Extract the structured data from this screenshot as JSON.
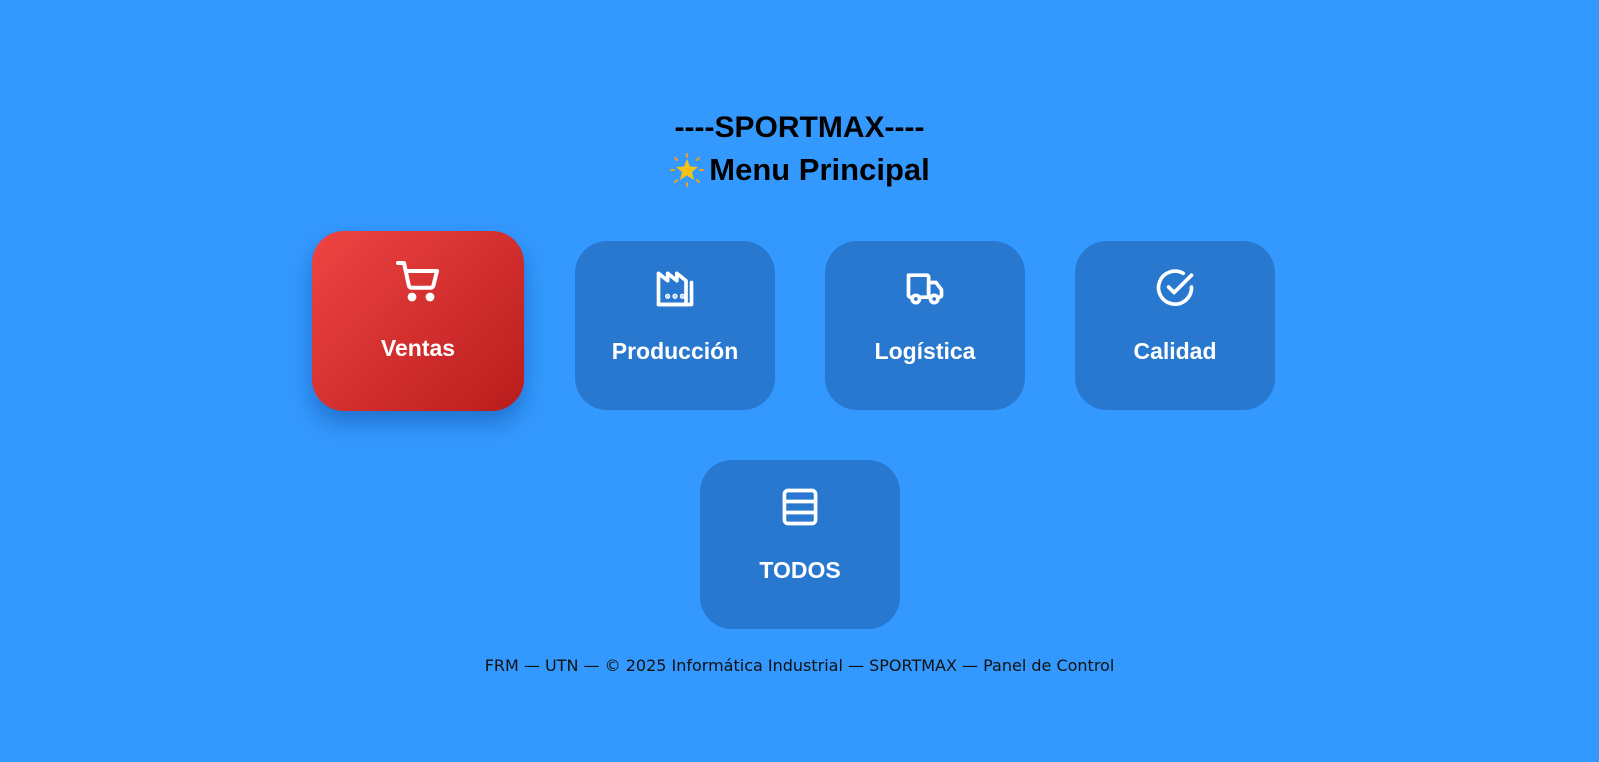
{
  "header": {
    "brand": "----SPORTMAX----",
    "menu_title": "Menu Principal",
    "menu_icon": "star-icon"
  },
  "cards": [
    {
      "label": "Ventas",
      "icon": "cart-icon",
      "active": true
    },
    {
      "label": "Producción",
      "icon": "factory-icon",
      "active": false
    },
    {
      "label": "Logística",
      "icon": "truck-icon",
      "active": false
    },
    {
      "label": "Calidad",
      "icon": "check-circle-icon",
      "active": false
    },
    {
      "label": "TODOS",
      "icon": "list-icon",
      "active": false
    }
  ],
  "footer": {
    "text": "FRM — UTN — © 2025 Informática Industrial — SPORTMAX — Panel de Control"
  },
  "colors": {
    "background": "#3399ff",
    "card": "#2878d0",
    "active_card_start": "#ef4444",
    "active_card_end": "#b91c1c"
  }
}
